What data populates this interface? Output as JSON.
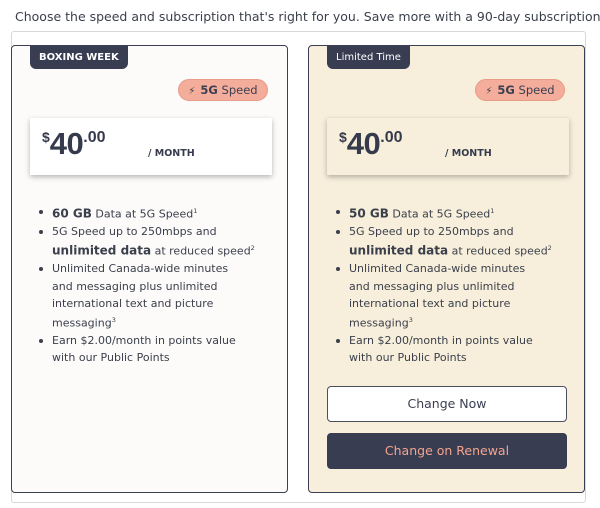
{
  "intro": "Choose the speed and subscription that's right for you. Save more with a 90-day subscription",
  "plans": [
    {
      "tag": "BOXING WEEK",
      "badge": {
        "icon": "lightning-icon",
        "bold": "5G",
        "text": "Speed"
      },
      "price": {
        "currency": "$",
        "amount": "40",
        "cents": ".00",
        "per": "/ MONTH"
      },
      "features": {
        "data_amount": "60 GB",
        "data_text": "Data at 5G Speed",
        "data_sup": "1",
        "speed_text": "5G Speed up to 250mbps and",
        "unlimited": "unlimited data",
        "reduced": "at reduced speed",
        "speed_sup": "2",
        "canada_line1": "Unlimited Canada-wide minutes",
        "canada_line2": "and messaging plus unlimited",
        "canada_line3": "international text and picture",
        "canada_line4": "messaging",
        "canada_sup": "3",
        "points_line1": "Earn $2.00/month in points value",
        "points_line2": "with our Public Points"
      }
    },
    {
      "tag": "Limited Time",
      "badge": {
        "icon": "lightning-icon",
        "bold": "5G",
        "text": "Speed"
      },
      "price": {
        "currency": "$",
        "amount": "40",
        "cents": ".00",
        "per": "/ MONTH"
      },
      "features": {
        "data_amount": "50 GB",
        "data_text": "Data at 5G Speed",
        "data_sup": "1",
        "speed_text": "5G Speed up to 250mbps and",
        "unlimited": "unlimited data",
        "reduced": "at reduced speed",
        "speed_sup": "2",
        "canada_line1": "Unlimited Canada-wide minutes",
        "canada_line2": "and messaging plus unlimited",
        "canada_line3": "international text and picture",
        "canada_line4": "messaging",
        "canada_sup": "3",
        "points_line1": "Earn $2.00/month in points value",
        "points_line2": "with our Public Points"
      },
      "buttons": {
        "change_now": "Change Now",
        "change_on_renewal": "Change on Renewal"
      }
    }
  ],
  "colors": {
    "dark": "#383d52",
    "badge": "#f3ad9a",
    "salmon_text": "#f3a48e",
    "card_highlight": "#f7efdb"
  }
}
